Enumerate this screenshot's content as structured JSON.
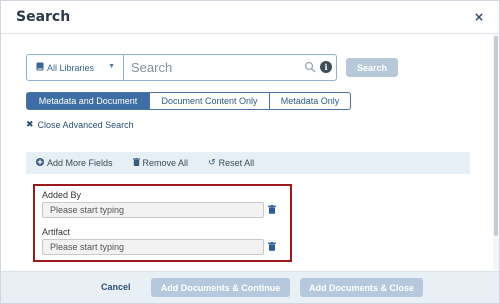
{
  "modal": {
    "title": "Search",
    "close_glyph": "×"
  },
  "search": {
    "library_label": "All Libraries",
    "placeholder": "Search",
    "value": "",
    "button_label": "Search"
  },
  "modes": [
    {
      "label": "Metadata and Document",
      "active": true
    },
    {
      "label": "Document Content Only",
      "active": false
    },
    {
      "label": "Metadata Only",
      "active": false
    }
  ],
  "close_advanced_label": "Close Advanced Search",
  "toolbar": {
    "add_more_fields": "Add More Fields",
    "remove_all": "Remove All",
    "reset_all": "Reset All"
  },
  "fields": [
    {
      "label": "Added By",
      "placeholder": "Please start typing"
    },
    {
      "label": "Artifact",
      "placeholder": "Please start typing"
    }
  ],
  "footer": {
    "cancel": "Cancel",
    "add_continue": "Add Documents & Continue",
    "add_close": "Add Documents & Close"
  },
  "colors": {
    "accent": "#3e6ea3",
    "highlight_border": "#9a1a1a",
    "disabled_button": "#b5c8dc"
  },
  "icons": [
    "book-icon",
    "chevron-down-icon",
    "search-icon",
    "info-icon",
    "plus-circle-icon",
    "trash-icon",
    "reset-icon",
    "close-icon"
  ]
}
